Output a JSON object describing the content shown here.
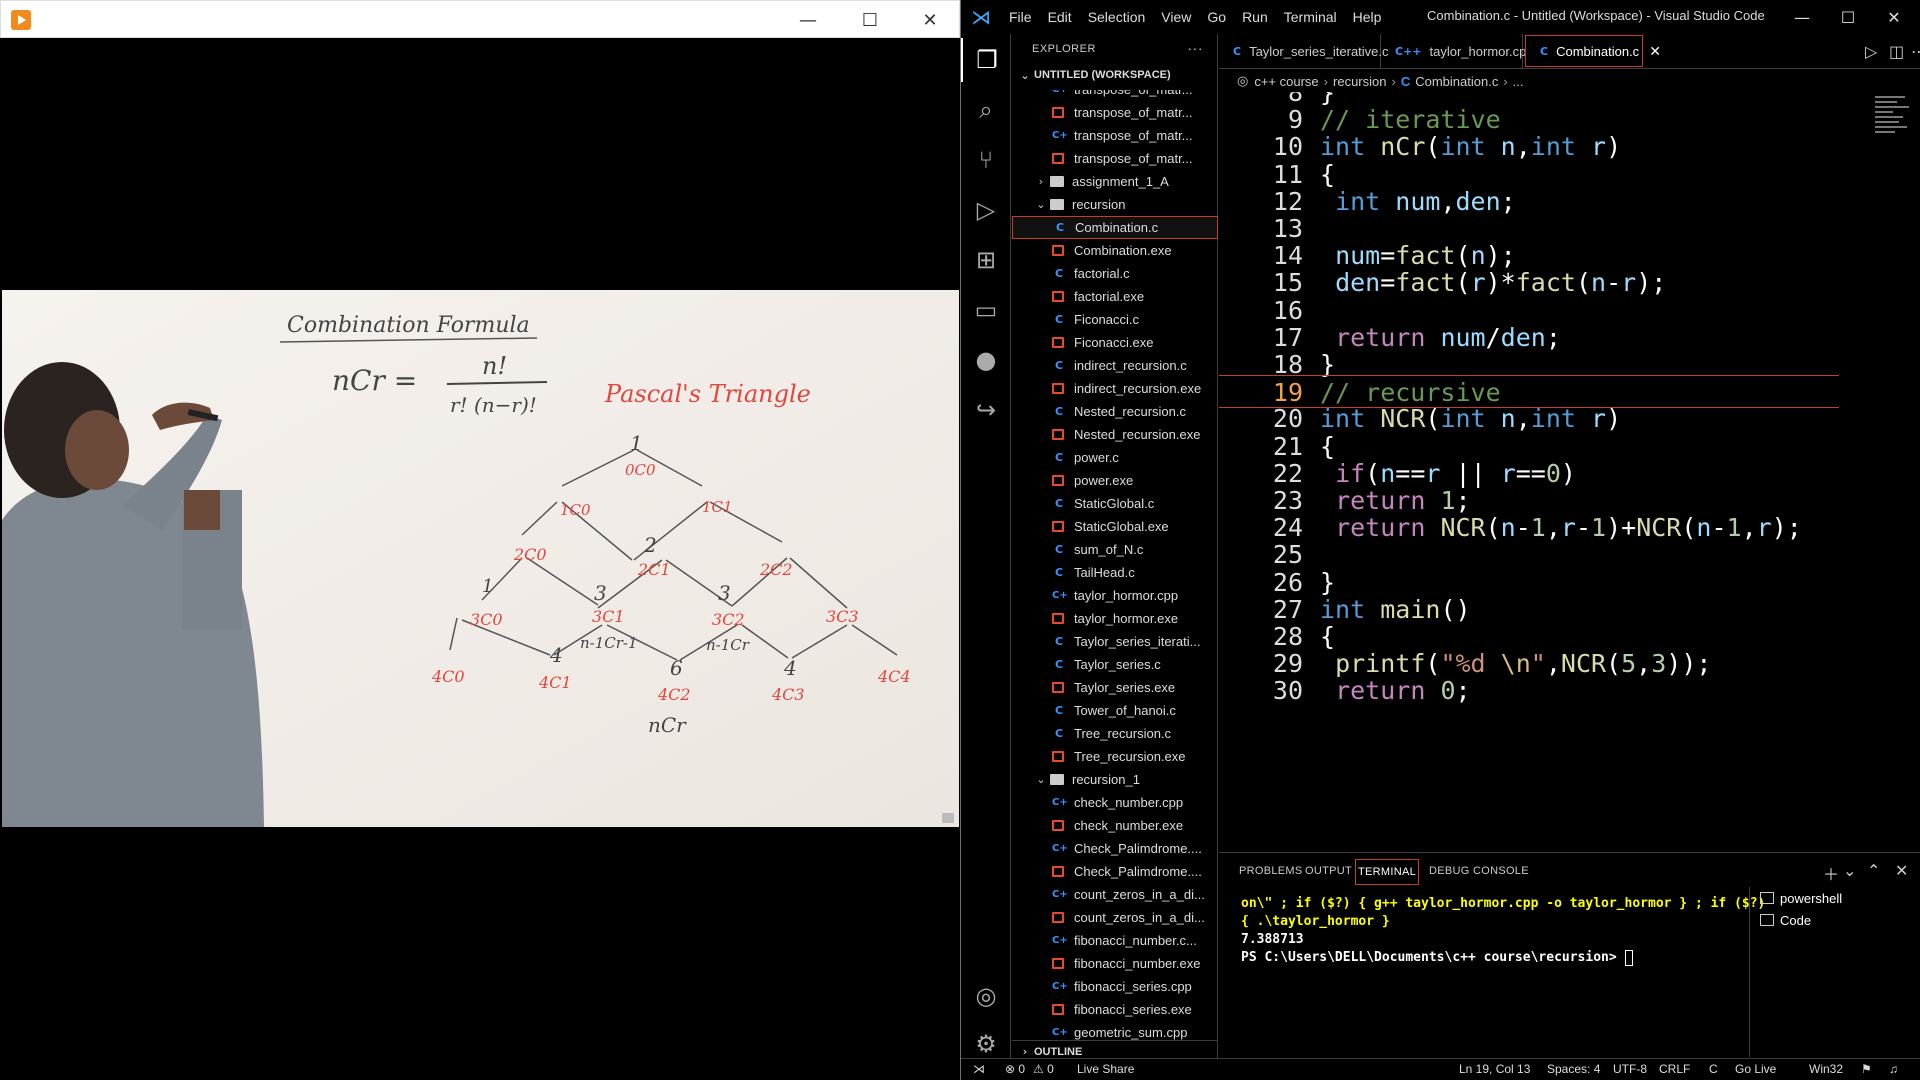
{
  "player": {
    "minimize": "—",
    "maximize": "☐",
    "close": "✕"
  },
  "whiteboard": {
    "title": "Combination Formula",
    "formula_lhs": "nCr =",
    "formula_num": "n!",
    "formula_den": "r! (n−r)!",
    "pascal_title": "Pascal's Triangle",
    "row0": [
      "1",
      "0C0"
    ],
    "row1": [
      "1C0",
      "1C1"
    ],
    "row2": [
      "2C0",
      "2",
      "2C1",
      "2C2"
    ],
    "row3": [
      "1",
      "3C0",
      "3",
      "3C1",
      "3",
      "3C2",
      "3C3"
    ],
    "row4": [
      "4C0",
      "4",
      "4C1",
      "6",
      "4C2",
      "4",
      "4C3",
      "4C4"
    ],
    "notes": [
      "n-1Cr-1",
      "n-1Cr",
      "nCr"
    ]
  },
  "vscode": {
    "menu": [
      "File",
      "Edit",
      "Selection",
      "View",
      "Go",
      "Run",
      "Terminal",
      "Help"
    ],
    "title": "Combination.c - Untitled (Workspace) - Visual Studio Code",
    "explorer_label": "EXPLORER",
    "workspace_label": "UNTITLED (WORKSPACE)",
    "tree": [
      {
        "type": "cpp",
        "label": "transpose_of_matr...",
        "indent": 2
      },
      {
        "type": "exe",
        "label": "transpose_of_matr...",
        "indent": 2
      },
      {
        "type": "cpp",
        "label": "transpose_of_matr...",
        "indent": 2
      },
      {
        "type": "exe",
        "label": "transpose_of_matr...",
        "indent": 2
      },
      {
        "type": "folder-closed",
        "label": "assignment_1_A",
        "indent": 1
      },
      {
        "type": "folder-open",
        "label": "recursion",
        "indent": 1
      },
      {
        "type": "c",
        "label": "Combination.c",
        "indent": 2
      },
      {
        "type": "exe",
        "label": "Combination.exe",
        "indent": 2
      },
      {
        "type": "c",
        "label": "factorial.c",
        "indent": 2
      },
      {
        "type": "exe",
        "label": "factorial.exe",
        "indent": 2
      },
      {
        "type": "c",
        "label": "Ficonacci.c",
        "indent": 2
      },
      {
        "type": "exe",
        "label": "Ficonacci.exe",
        "indent": 2
      },
      {
        "type": "c",
        "label": "indirect_recursion.c",
        "indent": 2
      },
      {
        "type": "exe",
        "label": "indirect_recursion.exe",
        "indent": 2
      },
      {
        "type": "c",
        "label": "Nested_recursion.c",
        "indent": 2
      },
      {
        "type": "exe",
        "label": "Nested_recursion.exe",
        "indent": 2
      },
      {
        "type": "c",
        "label": "power.c",
        "indent": 2
      },
      {
        "type": "exe",
        "label": "power.exe",
        "indent": 2
      },
      {
        "type": "c",
        "label": "StaticGlobal.c",
        "indent": 2
      },
      {
        "type": "exe",
        "label": "StaticGlobal.exe",
        "indent": 2
      },
      {
        "type": "c",
        "label": "sum_of_N.c",
        "indent": 2
      },
      {
        "type": "c",
        "label": "TailHead.c",
        "indent": 2
      },
      {
        "type": "cpp",
        "label": "taylor_hormor.cpp",
        "indent": 2
      },
      {
        "type": "exe",
        "label": "taylor_hormor.exe",
        "indent": 2
      },
      {
        "type": "c",
        "label": "Taylor_series_iterati...",
        "indent": 2
      },
      {
        "type": "c",
        "label": "Taylor_series.c",
        "indent": 2
      },
      {
        "type": "exe",
        "label": "Taylor_series.exe",
        "indent": 2
      },
      {
        "type": "c",
        "label": "Tower_of_hanoi.c",
        "indent": 2
      },
      {
        "type": "c",
        "label": "Tree_recursion.c",
        "indent": 2
      },
      {
        "type": "exe",
        "label": "Tree_recursion.exe",
        "indent": 2
      },
      {
        "type": "folder-open",
        "label": "recursion_1",
        "indent": 1
      },
      {
        "type": "cpp",
        "label": "check_number.cpp",
        "indent": 2
      },
      {
        "type": "exe",
        "label": "check_number.exe",
        "indent": 2
      },
      {
        "type": "cpp",
        "label": "Check_Palimdrome....",
        "indent": 2
      },
      {
        "type": "exe",
        "label": "Check_Palimdrome....",
        "indent": 2
      },
      {
        "type": "cpp",
        "label": "count_zeros_in_a_di...",
        "indent": 2
      },
      {
        "type": "exe",
        "label": "count_zeros_in_a_di...",
        "indent": 2
      },
      {
        "type": "cpp",
        "label": "fibonacci_number.c...",
        "indent": 2
      },
      {
        "type": "exe",
        "label": "fibonacci_number.exe",
        "indent": 2
      },
      {
        "type": "cpp",
        "label": "fibonacci_series.cpp",
        "indent": 2
      },
      {
        "type": "exe",
        "label": "fibonacci_series.exe",
        "indent": 2
      },
      {
        "type": "cpp",
        "label": "geometric_sum.cpp",
        "indent": 2
      }
    ],
    "outline_label": "OUTLINE",
    "tabs": [
      {
        "label": "Taylor_series_iterative.c",
        "icon": "C"
      },
      {
        "label": "taylor_hormor.cpp",
        "icon": "C++"
      },
      {
        "label": "Combination.c",
        "icon": "C"
      }
    ],
    "breadcrumb": [
      "c++ course",
      "recursion",
      "Combination.c",
      "..."
    ],
    "code_lines": [
      {
        "n": "8",
        "html": "}"
      },
      {
        "n": "9",
        "html": "<span class='cmt'>// iterative</span>"
      },
      {
        "n": "10",
        "html": "<span class='kw'>int</span> <span class='fn'>nCr</span>(<span class='kw'>int</span> <span class='var'>n</span>,<span class='kw'>int</span> <span class='var'>r</span>)"
      },
      {
        "n": "11",
        "html": "{"
      },
      {
        "n": "12",
        "html": " <span class='kw'>int</span> <span class='var'>num</span>,<span class='var'>den</span>;"
      },
      {
        "n": "13",
        "html": ""
      },
      {
        "n": "14",
        "html": " <span class='var'>num</span>=<span class='fn'>fact</span>(<span class='var'>n</span>);"
      },
      {
        "n": "15",
        "html": " <span class='var'>den</span>=<span class='fn'>fact</span>(<span class='var'>r</span>)*<span class='fn'>fact</span>(<span class='var'>n</span>-<span class='var'>r</span>);"
      },
      {
        "n": "16",
        "html": ""
      },
      {
        "n": "17",
        "html": " <span class='ctl'>return</span> <span class='var'>num</span>/<span class='var'>den</span>;"
      },
      {
        "n": "18",
        "html": "}"
      },
      {
        "n": "19",
        "html": "<span class='cmt'>// recursive</span>"
      },
      {
        "n": "20",
        "html": "<span class='kw'>int</span> <span class='fn'>NCR</span>(<span class='kw'>int</span> <span class='var'>n</span>,<span class='kw'>int</span> <span class='var'>r</span>)"
      },
      {
        "n": "21",
        "html": "{"
      },
      {
        "n": "22",
        "html": " <span class='ctl'>if</span>(<span class='var'>n</span>==<span class='var'>r</span> || <span class='var'>r</span>==<span class='num'>0</span>)"
      },
      {
        "n": "23",
        "html": " <span class='ctl'>return</span> <span class='num'>1</span>;"
      },
      {
        "n": "24",
        "html": " <span class='ctl'>return</span> <span class='fn'>NCR</span>(<span class='var'>n</span>-<span class='num'>1</span>,<span class='var'>r</span>-<span class='num'>1</span>)+<span class='fn'>NCR</span>(<span class='var'>n</span>-<span class='num'>1</span>,<span class='var'>r</span>);"
      },
      {
        "n": "25",
        "html": ""
      },
      {
        "n": "26",
        "html": "}"
      },
      {
        "n": "27",
        "html": "<span class='kw'>int</span> <span class='fn'>main</span>()"
      },
      {
        "n": "28",
        "html": "{"
      },
      {
        "n": "29",
        "html": " <span class='fn'>printf</span>(<span class='str'>\"%d </span><span class='esc'>\\n</span><span class='str'>\"</span>,<span class='fn'>NCR</span>(<span class='num'>5</span>,<span class='num'>3</span>));"
      },
      {
        "n": "30",
        "html": " <span class='ctl'>return</span> <span class='num'>0</span>;"
      }
    ],
    "current_line": "19",
    "panel_tabs": [
      "PROBLEMS",
      "OUTPUT",
      "TERMINAL",
      "DEBUG CONSOLE"
    ],
    "terminal": {
      "line1": "on\\\" ; if ($?) { g++ taylor_hormor.cpp -o taylor_hormor } ; if ($?)",
      "line2": " { .\\taylor_hormor }",
      "line3": "7.388713",
      "line4": "PS C:\\Users\\DELL\\Documents\\c++ course\\recursion> "
    },
    "terminal_list": [
      "powershell",
      "Code"
    ],
    "status": {
      "errors": "⊗ 0",
      "warnings": "⚠ 0",
      "live_share": "Live Share",
      "position": "Ln 19, Col 13",
      "spaces": "Spaces: 4",
      "encoding": "UTF-8",
      "eol": "CRLF",
      "lang": "C",
      "go_live": "Go Live",
      "platform": "Win32"
    }
  }
}
